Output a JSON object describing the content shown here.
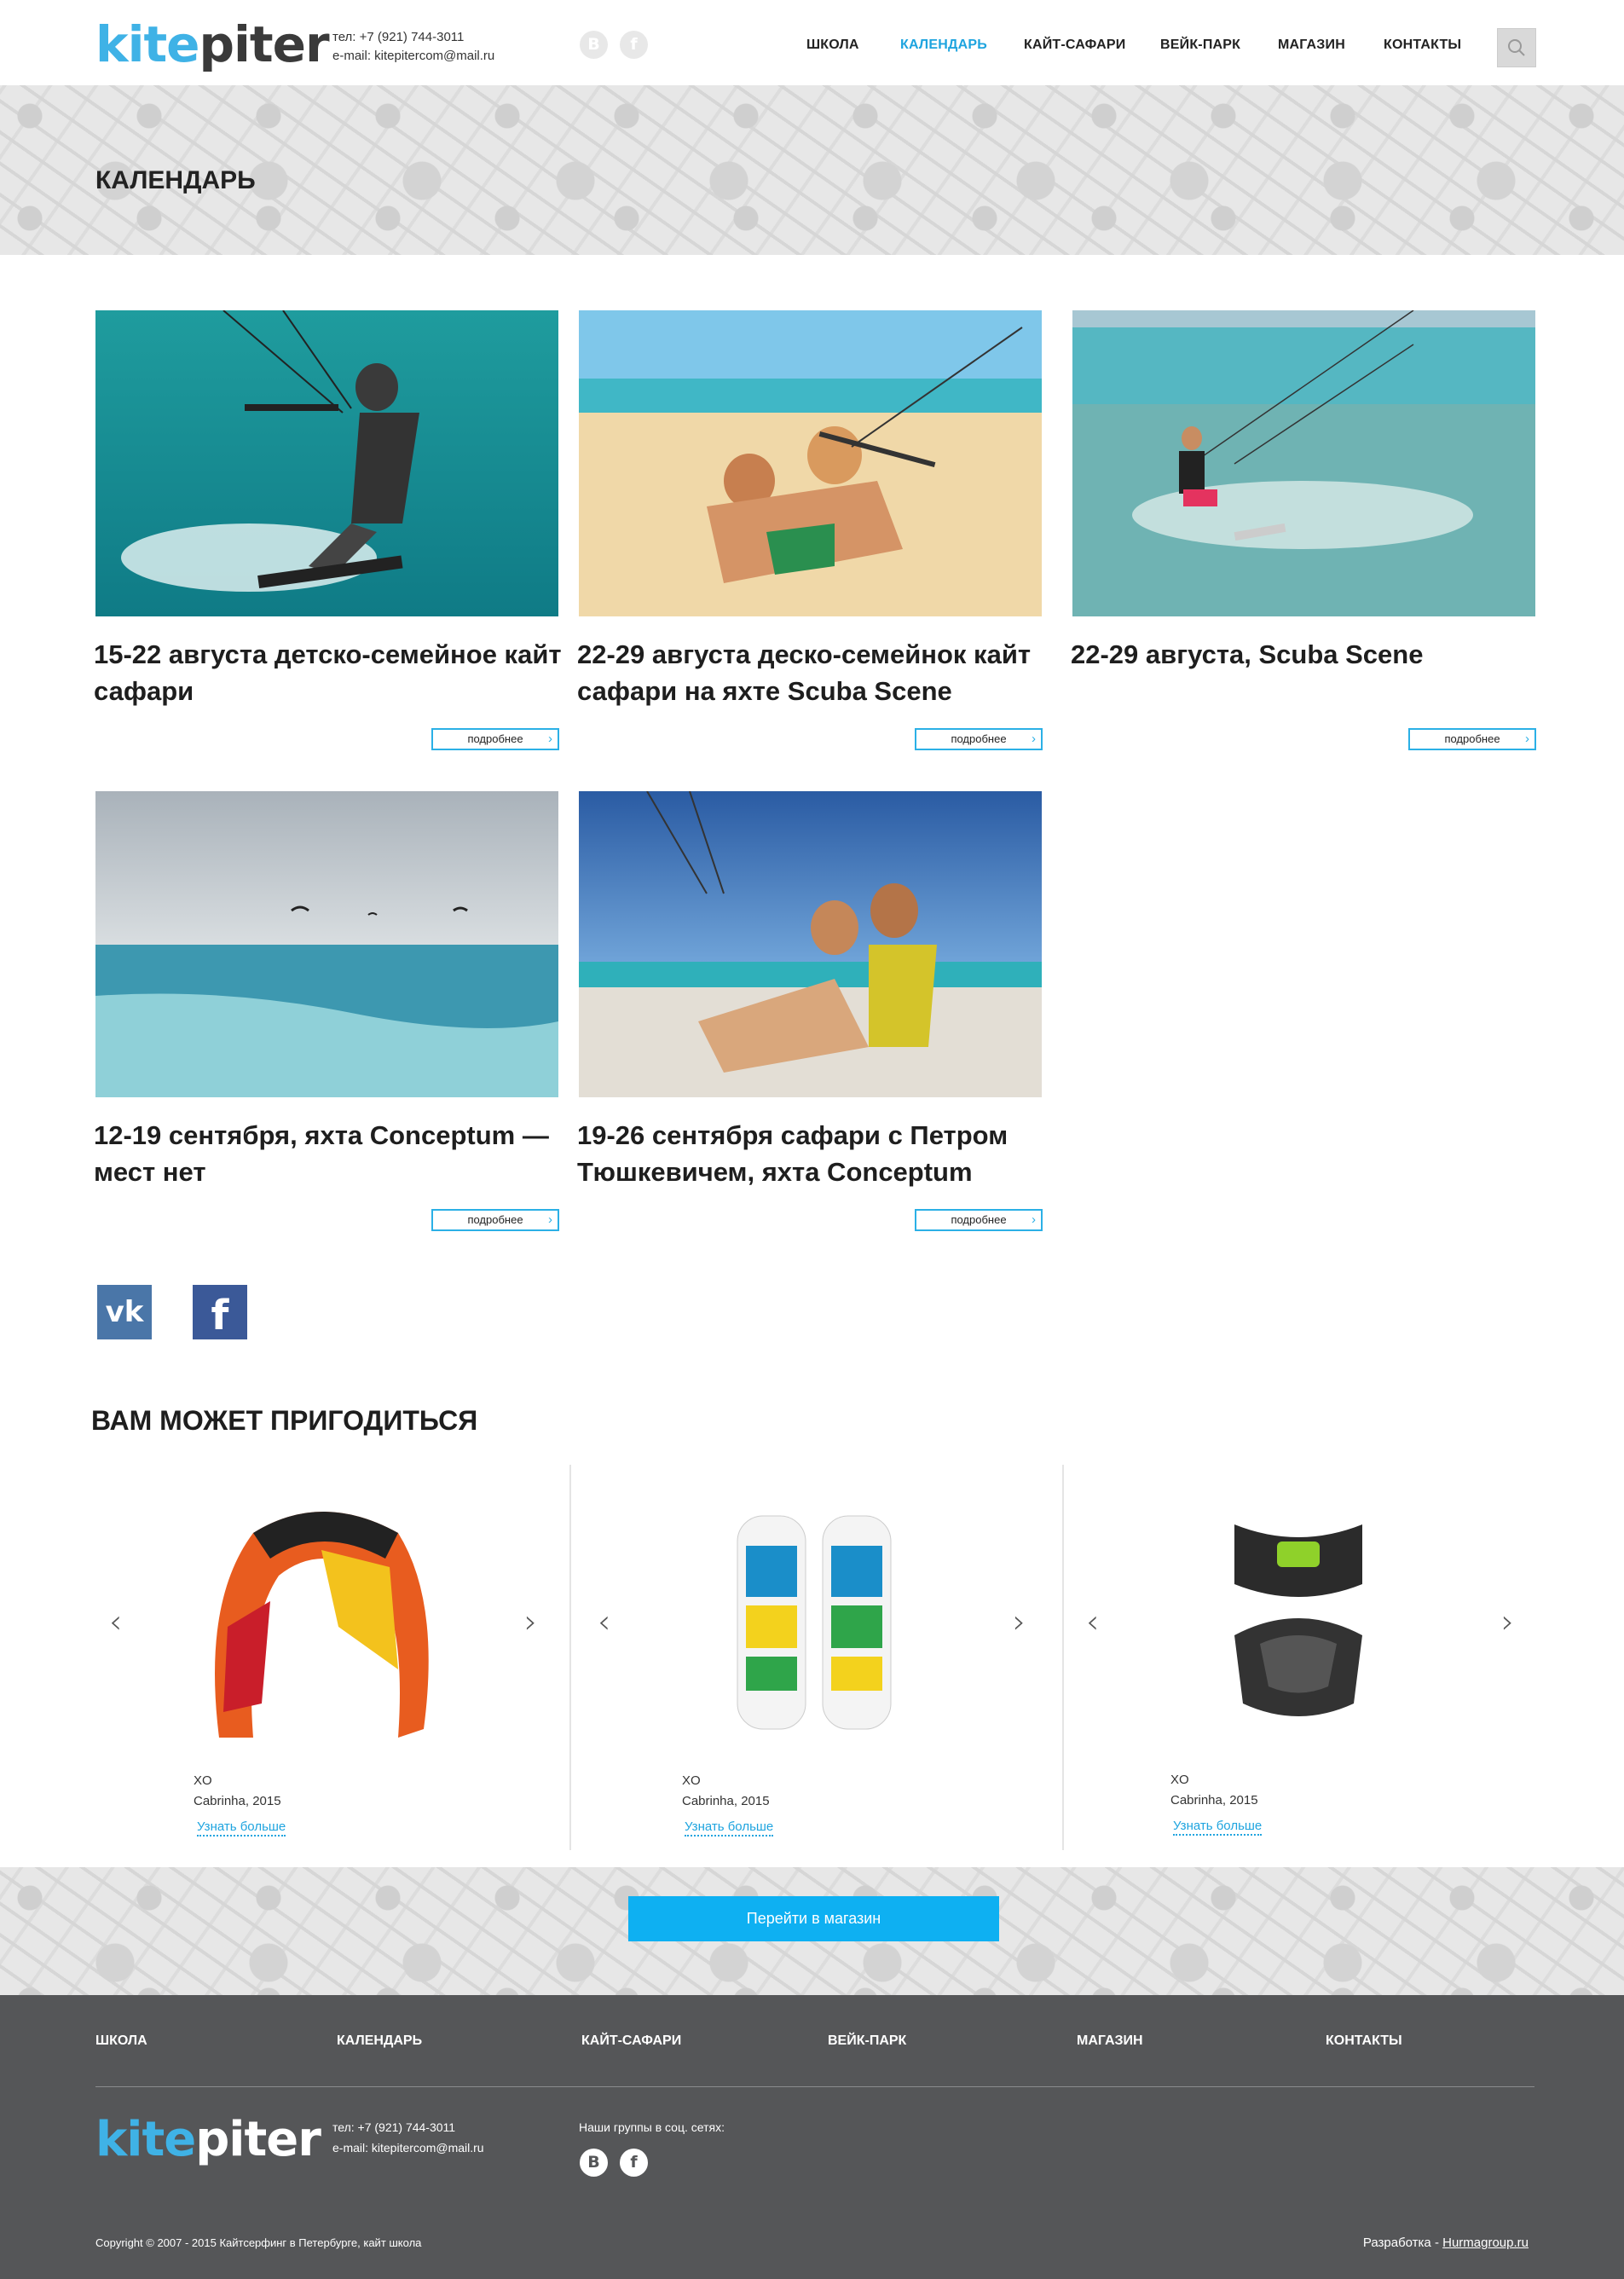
{
  "header": {
    "logo_part1": "kite",
    "logo_part2": "piter",
    "phone": "тел: +7 (921) 744-3011",
    "email": "e-mail: kitepitercom@mail.ru",
    "social": [
      "В",
      "f"
    ],
    "nav": [
      {
        "label": "ШКОЛА",
        "active": false
      },
      {
        "label": "КАЛЕНДАРЬ",
        "active": true
      },
      {
        "label": "КАЙТ-САФАРИ",
        "active": false
      },
      {
        "label": "ВЕЙК-ПАРК",
        "active": false
      },
      {
        "label": "МАГАЗИН",
        "active": false
      },
      {
        "label": "КОНТАКТЫ",
        "active": false
      }
    ],
    "search_icon": "search-icon"
  },
  "page_title": "КАЛЕНДАРЬ",
  "events": [
    {
      "title": "15-22 августа детско-семейное кайт сафари",
      "more": "подробнее"
    },
    {
      "title": "22-29 августа деско-семейнок кайт сафари на яхте Scuba Scene",
      "more": "подробнее"
    },
    {
      "title": "22-29 августа, Scuba Scene",
      "more": "подробнее"
    },
    {
      "title": "12-19 сентября, яхта Conceptum — мест нет",
      "more": "подробнее"
    },
    {
      "title": "19-26 сентября сафари с Петром Тюшкевичем, яхта Conceptum",
      "more": "подробнее"
    }
  ],
  "social_share": {
    "vk": "vk",
    "fb": "f"
  },
  "section_title": "ВАМ МОЖЕТ ПРИГОДИТЬСЯ",
  "products": [
    {
      "name": "XO",
      "sub": "Cabrinha, 2015",
      "link": "Узнать больше"
    },
    {
      "name": "XO",
      "sub": "Cabrinha, 2015",
      "link": "Узнать больше"
    },
    {
      "name": "XO",
      "sub": "Cabrinha, 2015",
      "link": "Узнать больше"
    }
  ],
  "shop_button": "Перейти в магазин",
  "footer": {
    "nav": [
      "ШКОЛА",
      "КАЛЕНДАРЬ",
      "КАЙТ-САФАРИ",
      "ВЕЙК-ПАРК",
      "МАГАЗИН",
      "КОНТАКТЫ"
    ],
    "phone": "тел: +7 (921) 744-3011",
    "email": "e-mail: kitepitercom@mail.ru",
    "social_title": "Наши группы в соц. сетях:",
    "social": [
      "В",
      "f"
    ],
    "copyright": "Copyright © 2007 - 2015 Кайтсерфинг в Петербурге, кайт школа",
    "dev_label": "Разработка - ",
    "dev_link": "Hurmagroup.ru"
  },
  "colors": {
    "accent": "#1ea4df",
    "button": "#0eb0f2",
    "footer": "#555658",
    "vk": "#4a76a8",
    "fb": "#3b5998"
  }
}
